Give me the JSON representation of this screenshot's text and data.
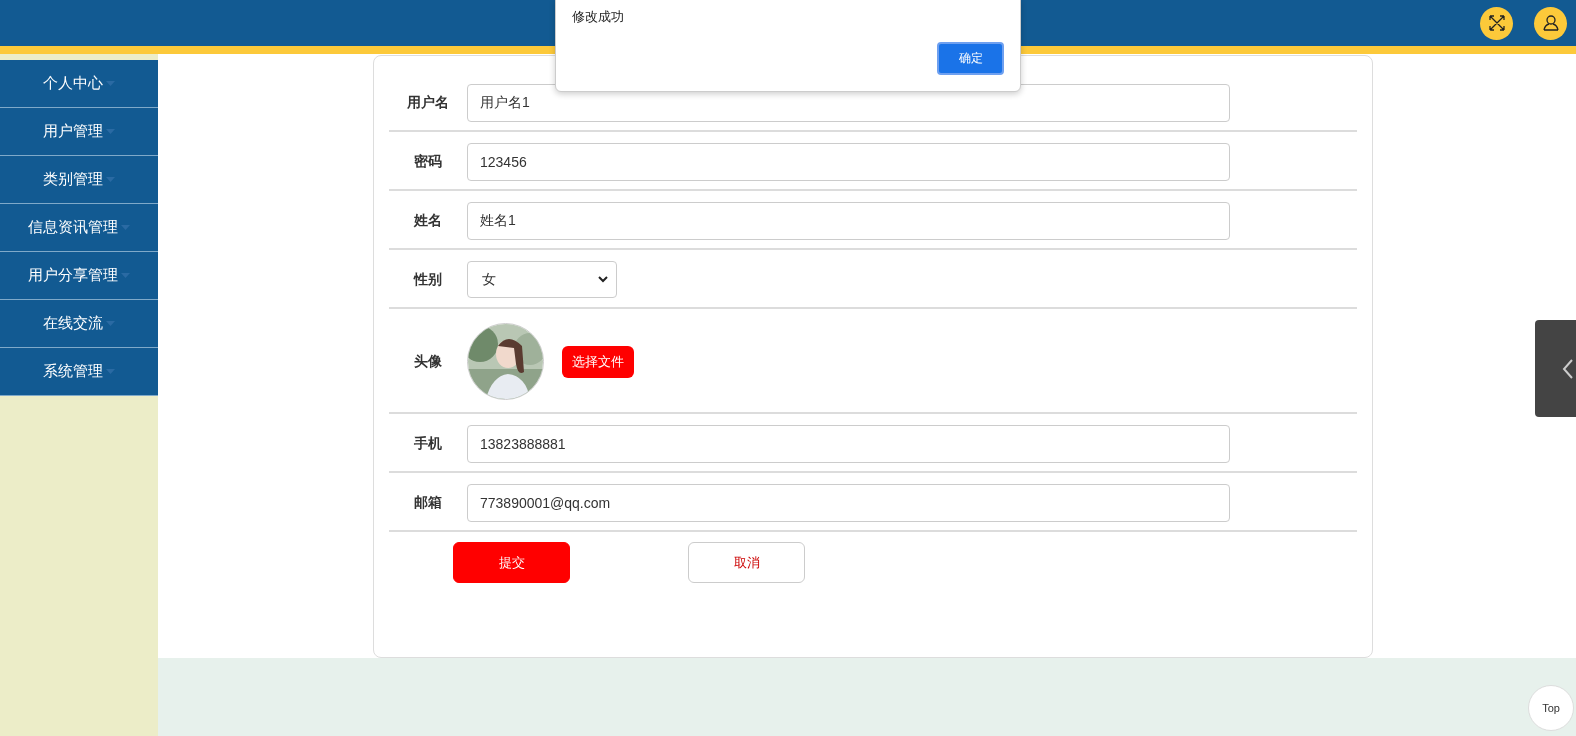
{
  "sidebar": {
    "items": [
      {
        "label": "个人中心"
      },
      {
        "label": "用户管理"
      },
      {
        "label": "类别管理"
      },
      {
        "label": "信息资讯管理"
      },
      {
        "label": "用户分享管理"
      },
      {
        "label": "在线交流"
      },
      {
        "label": "系统管理"
      }
    ]
  },
  "form": {
    "fields": [
      {
        "kind": "text",
        "label": "用户名",
        "value": "用户名1"
      },
      {
        "kind": "text",
        "label": "密码",
        "value": "123456"
      },
      {
        "kind": "text",
        "label": "姓名",
        "value": "姓名1"
      },
      {
        "kind": "select",
        "label": "性别",
        "value": "女"
      },
      {
        "kind": "avatar",
        "label": "头像",
        "button": "选择文件"
      },
      {
        "kind": "text",
        "label": "手机",
        "value": "13823888881"
      },
      {
        "kind": "text",
        "label": "邮箱",
        "value": "773890001@qq.com"
      }
    ],
    "submit": "提交",
    "cancel": "取消"
  },
  "dialog": {
    "message": "修改成功",
    "ok": "确定"
  },
  "back_to_top": "Top"
}
